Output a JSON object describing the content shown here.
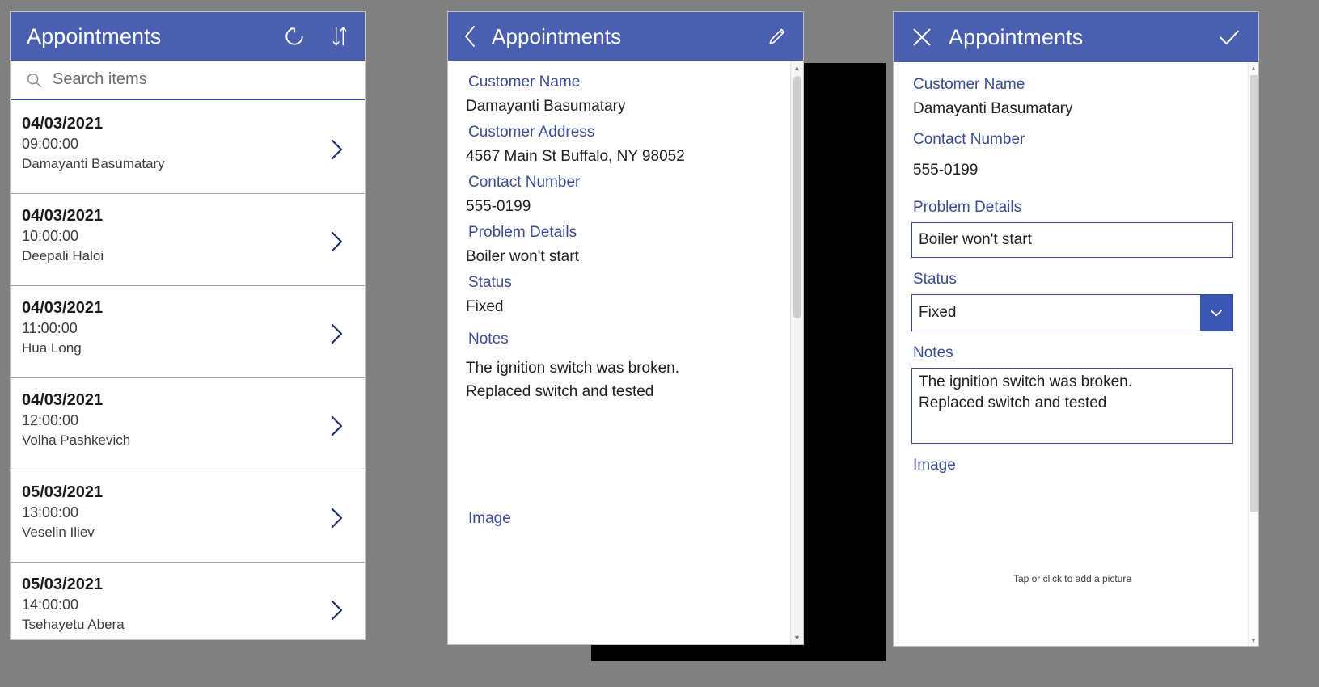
{
  "app": {
    "accent_color": "#4a5fb0",
    "label_color": "#3b4c96",
    "background_color": "#808080"
  },
  "browse_screen": {
    "title": "Appointments",
    "icons": {
      "refresh": "refresh-icon",
      "sort": "sort-icon",
      "search": "search-icon",
      "chevron": "chevron-right-icon"
    },
    "search": {
      "placeholder": "Search items",
      "value": ""
    },
    "items": [
      {
        "date": "04/03/2021",
        "time": "09:00:00",
        "name": "Damayanti Basumatary"
      },
      {
        "date": "04/03/2021",
        "time": "10:00:00",
        "name": "Deepali Haloi"
      },
      {
        "date": "04/03/2021",
        "time": "11:00:00",
        "name": "Hua Long"
      },
      {
        "date": "04/03/2021",
        "time": "12:00:00",
        "name": "Volha Pashkevich"
      },
      {
        "date": "05/03/2021",
        "time": "13:00:00",
        "name": "Veselin Iliev"
      },
      {
        "date": "05/03/2021",
        "time": "14:00:00",
        "name": "Tsehayetu Abera"
      }
    ]
  },
  "detail_screen": {
    "title": "Appointments",
    "icons": {
      "back": "chevron-left-icon",
      "edit": "pencil-icon"
    },
    "fields": [
      {
        "label": "Customer Name",
        "value": "Damayanti Basumatary"
      },
      {
        "label": "Customer Address",
        "value": "4567 Main St Buffalo, NY 98052"
      },
      {
        "label": "Contact Number",
        "value": "555-0199"
      },
      {
        "label": "Problem Details",
        "value": "Boiler won't start"
      },
      {
        "label": "Status",
        "value": "Fixed"
      },
      {
        "label": "Notes",
        "value": "The ignition switch was broken.\nReplaced switch and tested"
      }
    ],
    "image_label": "Image"
  },
  "edit_screen": {
    "title": "Appointments",
    "icons": {
      "cancel": "close-icon",
      "save": "check-icon",
      "dropdown": "chevron-down-icon"
    },
    "customer_name": {
      "label": "Customer Name",
      "value": "Damayanti Basumatary"
    },
    "contact_number": {
      "label": "Contact Number",
      "value": "555-0199"
    },
    "problem_details": {
      "label": "Problem Details",
      "value": "Boiler won't start"
    },
    "status": {
      "label": "Status",
      "value": "Fixed"
    },
    "notes": {
      "label": "Notes",
      "value": "The ignition switch was broken.\nReplaced switch and tested"
    },
    "image": {
      "label": "Image",
      "hint": "Tap or click to add a picture"
    }
  }
}
